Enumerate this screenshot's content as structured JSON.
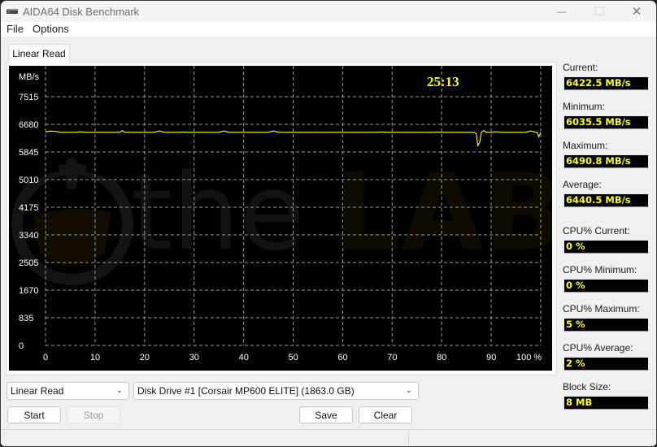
{
  "window": {
    "title": "AIDA64 Disk Benchmark",
    "icon": "disk-drive-icon",
    "controls": {
      "minimize": "—",
      "maximize": "☐",
      "close": "✕"
    }
  },
  "menu": {
    "items": [
      "File",
      "Options"
    ]
  },
  "tabs": [
    {
      "label": "Linear Read",
      "active": true
    }
  ],
  "timer": "25:13",
  "watermark": {
    "text_a": "the",
    "text_b": "LAB"
  },
  "chart_data": {
    "type": "line",
    "title": "",
    "ylabel": "MB/s",
    "xlabel": "%",
    "ylim": [
      0,
      8350
    ],
    "xlim": [
      0,
      100
    ],
    "y_ticks": [
      0,
      835,
      1670,
      2505,
      3340,
      4175,
      5010,
      5845,
      6680,
      7515
    ],
    "x_ticks": [
      0,
      10,
      20,
      30,
      40,
      50,
      60,
      70,
      80,
      90,
      100
    ],
    "x_tick_labels": [
      "0",
      "10",
      "20",
      "30",
      "40",
      "50",
      "60",
      "70",
      "80",
      "90",
      "100 %"
    ],
    "grid": true,
    "line_color": "#ffff00",
    "series": [
      {
        "name": "Linear Read",
        "x": [
          0,
          0.5,
          1,
          2,
          3,
          4,
          5,
          6,
          7,
          8,
          9,
          10,
          11,
          12,
          13,
          14,
          15,
          15.5,
          16,
          17,
          18,
          19,
          20,
          21,
          22,
          23,
          24,
          25,
          26,
          27,
          28,
          29,
          30,
          31,
          32,
          33,
          34,
          35,
          36,
          37,
          38,
          39,
          40,
          41,
          42,
          43,
          44,
          45,
          46,
          47,
          48,
          49,
          50,
          51,
          52,
          53,
          54,
          55,
          56,
          57,
          58,
          59,
          60,
          61,
          62,
          63,
          64,
          65,
          66,
          67,
          68,
          69,
          70,
          71,
          72,
          73,
          74,
          75,
          76,
          77,
          78,
          79,
          80,
          81,
          82,
          83,
          84,
          85,
          86,
          86.5,
          87,
          87.3,
          87.7,
          88,
          88.5,
          89,
          90,
          91,
          92,
          93,
          94,
          95,
          96,
          97,
          98,
          99,
          99.3,
          99.6,
          100
        ],
        "y": [
          6440,
          6470,
          6475,
          6470,
          6440,
          6440,
          6440,
          6440,
          6455,
          6440,
          6440,
          6440,
          6440,
          6440,
          6440,
          6440,
          6440,
          6490,
          6440,
          6440,
          6440,
          6440,
          6440,
          6440,
          6440,
          6480,
          6440,
          6440,
          6440,
          6440,
          6450,
          6440,
          6440,
          6440,
          6440,
          6440,
          6440,
          6440,
          6480,
          6440,
          6440,
          6440,
          6440,
          6440,
          6440,
          6440,
          6440,
          6440,
          6480,
          6440,
          6440,
          6440,
          6440,
          6440,
          6440,
          6440,
          6440,
          6440,
          6440,
          6440,
          6440,
          6440,
          6440,
          6440,
          6440,
          6440,
          6440,
          6440,
          6440,
          6440,
          6450,
          6440,
          6440,
          6440,
          6440,
          6440,
          6440,
          6440,
          6440,
          6440,
          6440,
          6450,
          6440,
          6440,
          6440,
          6440,
          6440,
          6440,
          6440,
          6440,
          6400,
          6035,
          6150,
          6440,
          6490,
          6440,
          6440,
          6460,
          6440,
          6440,
          6440,
          6440,
          6440,
          6440,
          6480,
          6440,
          6440,
          6300,
          6440,
          6422
        ]
      }
    ]
  },
  "stats": [
    {
      "label": "Current:",
      "value": "6422.5 MB/s"
    },
    {
      "label": "Minimum:",
      "value": "6035.5 MB/s"
    },
    {
      "label": "Maximum:",
      "value": "6490.8 MB/s"
    },
    {
      "label": "Average:",
      "value": "6440.5 MB/s"
    },
    {
      "label": "CPU% Current:",
      "value": "0 %"
    },
    {
      "label": "CPU% Minimum:",
      "value": "0 %"
    },
    {
      "label": "CPU% Maximum:",
      "value": "5 %"
    },
    {
      "label": "CPU% Average:",
      "value": "2 %"
    },
    {
      "label": "Block Size:",
      "value": "8 MB"
    }
  ],
  "controls": {
    "test_select": "Linear Read",
    "drive_select": "Disk Drive #1  [Corsair MP600 ELITE]  (1863.0 GB)",
    "start": "Start",
    "stop": "Stop",
    "save": "Save",
    "clear": "Clear"
  },
  "status": {
    "left": "",
    "right": ""
  }
}
